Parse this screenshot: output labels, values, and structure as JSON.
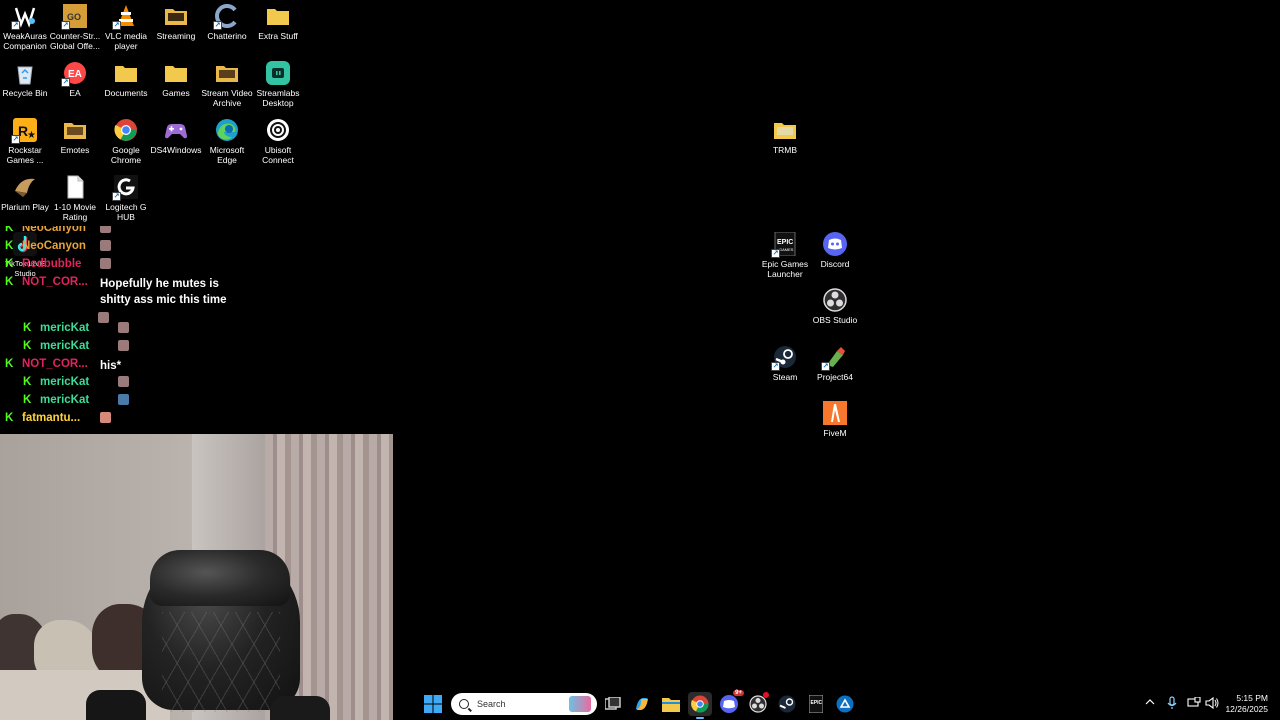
{
  "desktop_icons": [
    {
      "id": "weakauras",
      "label": "WeakAuras Companion",
      "icon": "weakauras-icon"
    },
    {
      "id": "csgo",
      "label": "Counter-Str... Global Offe...",
      "icon": "csgo-icon"
    },
    {
      "id": "vlc",
      "label": "VLC media player",
      "icon": "vlc-icon"
    },
    {
      "id": "streaming",
      "label": "Streaming",
      "icon": "folder-icon"
    },
    {
      "id": "chatterino",
      "label": "Chatterino",
      "icon": "chatterino-icon"
    },
    {
      "id": "extrastuff",
      "label": "Extra Stuff",
      "icon": "folder-icon"
    },
    {
      "id": "recyclebin",
      "label": "Recycle Bin",
      "icon": "recycle-bin-icon"
    },
    {
      "id": "ea",
      "label": "EA",
      "icon": "ea-icon"
    },
    {
      "id": "documents",
      "label": "Documents",
      "icon": "folder-icon"
    },
    {
      "id": "games",
      "label": "Games",
      "icon": "folder-icon"
    },
    {
      "id": "streamvideoarchive",
      "label": "Stream Video Archive",
      "icon": "folder-icon"
    },
    {
      "id": "streamlabs",
      "label": "Streamlabs Desktop",
      "icon": "streamlabs-icon"
    },
    {
      "id": "rockstar",
      "label": "Rockstar Games ...",
      "icon": "rockstar-icon"
    },
    {
      "id": "emotes",
      "label": "Emotes",
      "icon": "folder-icon"
    },
    {
      "id": "chrome",
      "label": "Google Chrome",
      "icon": "chrome-icon"
    },
    {
      "id": "ds4windows",
      "label": "DS4Windows",
      "icon": "gamepad-icon"
    },
    {
      "id": "edge",
      "label": "Microsoft Edge",
      "icon": "edge-icon"
    },
    {
      "id": "ubisoft",
      "label": "Ubisoft Connect",
      "icon": "ubisoft-icon"
    },
    {
      "id": "plarium",
      "label": "Plarium Play",
      "icon": "plarium-icon"
    },
    {
      "id": "movierating",
      "label": "1-10 Movie Rating",
      "icon": "document-icon"
    },
    {
      "id": "logitech",
      "label": "Logitech G HUB",
      "icon": "logitech-icon"
    },
    {
      "id": "tiktok",
      "label": "TikTok LIVE Studio",
      "icon": "tiktok-icon"
    },
    {
      "id": "trmb",
      "label": "TRMB",
      "icon": "folder-icon"
    },
    {
      "id": "epic",
      "label": "Epic Games Launcher",
      "icon": "epic-icon"
    },
    {
      "id": "discord",
      "label": "Discord",
      "icon": "discord-icon"
    },
    {
      "id": "obs",
      "label": "OBS Studio",
      "icon": "obs-icon"
    },
    {
      "id": "steam",
      "label": "Steam",
      "icon": "steam-icon"
    },
    {
      "id": "project64",
      "label": "Project64",
      "icon": "project64-icon"
    },
    {
      "id": "fivem",
      "label": "FiveM",
      "icon": "fivem-icon"
    }
  ],
  "chat": {
    "messages": [
      {
        "user": "NeoCanyon",
        "color": "#e8a33a",
        "text": ""
      },
      {
        "user": "NeoCanyon",
        "color": "#e8a33a",
        "text": ""
      },
      {
        "user": "Redbubble",
        "color": "#e0245e",
        "text": ""
      },
      {
        "user": "NOT_COR...",
        "color": "#e0245e",
        "text": "Hopefully he mutes is shitty ass mic this time"
      },
      {
        "user": "mericKat",
        "color": "#3ddc97",
        "text": ""
      },
      {
        "user": "mericKat",
        "color": "#3ddc97",
        "text": ""
      },
      {
        "user": "NOT_COR...",
        "color": "#e0245e",
        "text": "his*"
      },
      {
        "user": "mericKat",
        "color": "#3ddc97",
        "text": ""
      },
      {
        "user": "mericKat",
        "color": "#3ddc97",
        "text": ""
      },
      {
        "user": "fatmantu...",
        "color": "#ffd43b",
        "text": ""
      }
    ]
  },
  "taskbar": {
    "search_placeholder": "Search",
    "time": "5:15 PM",
    "date": "12/26/2025",
    "discord_badge": "9+"
  }
}
